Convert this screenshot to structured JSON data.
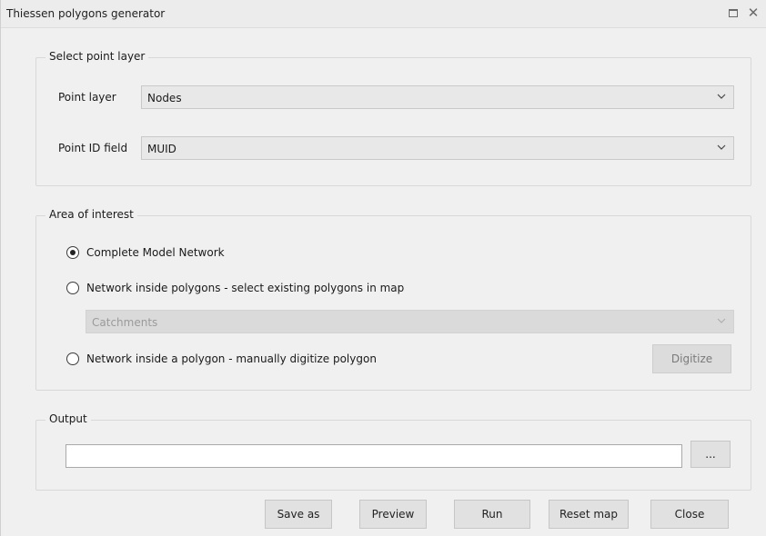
{
  "window": {
    "title": "Thiessen polygons generator"
  },
  "select_point_layer": {
    "legend": "Select point layer",
    "point_layer_label": "Point layer",
    "point_layer_value": "Nodes",
    "point_id_label": "Point ID field",
    "point_id_value": "MUID"
  },
  "area_of_interest": {
    "legend": "Area of interest",
    "option_complete": "Complete Model Network",
    "option_inside_polygons": "Network inside polygons - select existing polygons in map",
    "polygons_layer_value": "Catchments",
    "option_manual_polygon": "Network inside a polygon - manually digitize polygon",
    "digitize_label": "Digitize",
    "selected": "option_complete"
  },
  "output": {
    "legend": "Output",
    "path_value": "",
    "browse_label": "..."
  },
  "footer": {
    "save_as_label": "Save as",
    "preview_label": "Preview",
    "run_label": "Run",
    "reset_map_label": "Reset map",
    "close_label": "Close"
  },
  "icons": {
    "dropdown": "chevron-down-icon",
    "maximize": "maximize-icon",
    "close": "close-icon"
  }
}
